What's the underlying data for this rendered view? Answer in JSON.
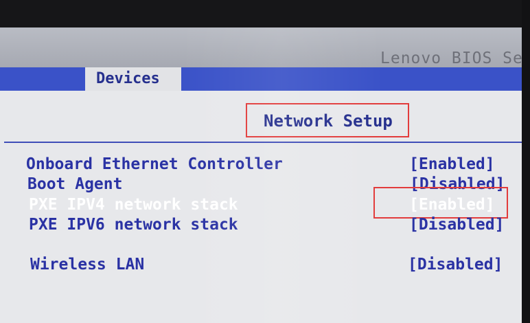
{
  "header": {
    "app_title": "Lenovo BIOS Se"
  },
  "tabs": [
    {
      "label": "Devices",
      "active": true
    }
  ],
  "section": {
    "title": "Network Setup"
  },
  "settings": [
    {
      "label": "Onboard Ethernet Controller",
      "value": "[Enabled]"
    },
    {
      "label": "Boot Agent",
      "value": "[Disabled]"
    },
    {
      "label": "PXE IPV4 network stack",
      "value": "[Enabled]",
      "selected": true
    },
    {
      "label": "PXE IPV6 network stack",
      "value": "[Disabled]"
    },
    {
      "label": "Wireless LAN",
      "value": "[Disabled]"
    }
  ],
  "colors": {
    "accent": "#3a52c8",
    "text": "#2a32a4",
    "highlight_box": "#e23b3b"
  }
}
